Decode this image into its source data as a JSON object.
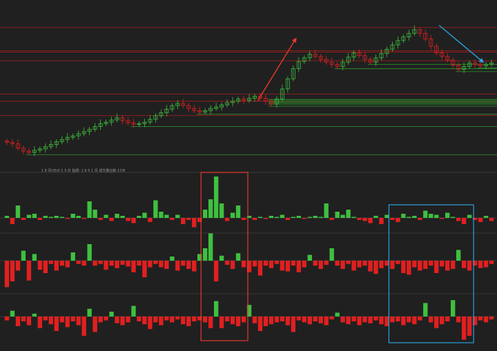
{
  "colors": {
    "background": "#202020",
    "up": "#3fbf3f",
    "down": "#e02020",
    "support_line": "#2e9e2e",
    "resistance_line": "#b01e1e",
    "annotation_red": "#e83a2a",
    "annotation_blue": "#2aa3e0"
  },
  "chart_data": [
    {
      "type": "candlestick",
      "title": "",
      "x_axis_text": "1 6 月(日)0 1 3 日 指標: 1 6 5 1 月 成交量比較 17/8",
      "close": [
        8.2,
        8.0,
        7.4,
        7.0,
        6.8,
        7.1,
        7.3,
        7.6,
        7.9,
        8.3,
        8.6,
        8.9,
        9.1,
        9.4,
        9.7,
        10.0,
        10.4,
        10.8,
        11.0,
        11.3,
        11.6,
        11.2,
        10.9,
        10.7,
        10.8,
        11.0,
        11.4,
        11.9,
        12.3,
        12.8,
        13.3,
        13.6,
        13.3,
        12.9,
        12.6,
        12.4,
        12.6,
        12.9,
        13.1,
        13.4,
        13.7,
        13.9,
        14.2,
        14.0,
        14.3,
        14.6,
        14.3,
        13.9,
        13.5,
        14.2,
        15.6,
        17.0,
        18.4,
        19.4,
        19.9,
        20.4,
        20.1,
        19.7,
        19.3,
        19.0,
        18.7,
        19.3,
        20.0,
        20.6,
        20.2,
        19.7,
        19.3,
        19.9,
        20.5,
        21.1,
        21.7,
        22.3,
        22.8,
        23.3,
        23.8,
        23.3,
        22.5,
        21.5,
        20.6,
        20.1,
        19.6,
        18.9,
        18.3,
        18.7,
        19.2,
        19.0,
        18.8,
        19.0,
        19.2
      ]
    },
    {
      "type": "bar",
      "title": "",
      "values": [
        0.2,
        -0.6,
        1.2,
        -0.2,
        0.3,
        0.4,
        -0.2,
        0.2,
        0.1,
        0.2,
        0.1,
        -0.1,
        0.4,
        0.2,
        -0.1,
        1.6,
        0.8,
        -0.2,
        0.3,
        -0.3,
        0.4,
        0.2,
        -0.3,
        -0.5,
        0.2,
        0.5,
        -0.4,
        1.7,
        0.6,
        0.3,
        -0.2,
        0.3,
        -0.6,
        -0.2,
        -0.9,
        -0.4,
        0.8,
        1.8,
        4.0,
        1.4,
        -0.3,
        0.5,
        1.2,
        -0.2,
        0.2,
        -0.2,
        0.1,
        -0.1,
        0.2,
        0.1,
        0.3,
        -0.2,
        0.1,
        0.2,
        -0.1,
        0.1,
        0.2,
        0.1,
        1.4,
        -0.2,
        0.6,
        0.3,
        0.8,
        0.1,
        -0.2,
        -0.3,
        -0.5,
        0.2,
        -0.6,
        0.3,
        -0.2,
        -0.4,
        0.4,
        0.1,
        0.2,
        -0.2,
        0.7,
        0.4,
        0.3,
        -0.1,
        0.5,
        0.1,
        -0.3,
        -0.6,
        0.3,
        -0.2,
        -0.4,
        0.2,
        -0.3
      ]
    },
    {
      "type": "bar",
      "title": "",
      "values": [
        -3.2,
        -2.5,
        -1.2,
        1.2,
        -2.4,
        0.8,
        -1.1,
        -1.5,
        -0.4,
        -1.2,
        -0.6,
        -0.8,
        1.0,
        -0.4,
        -0.6,
        2.0,
        -0.6,
        -0.4,
        -1.1,
        -0.6,
        -0.9,
        -0.5,
        -0.7,
        -1.4,
        -0.6,
        -2.0,
        -0.8,
        -0.4,
        -0.8,
        -1.0,
        0.5,
        -1.2,
        -0.6,
        -1.0,
        -1.3,
        0.8,
        1.5,
        3.3,
        -2.5,
        0.6,
        -0.5,
        -1.0,
        0.9,
        -0.8,
        -1.4,
        -0.7,
        -1.8,
        -0.6,
        -0.9,
        -0.4,
        -1.2,
        -1.3,
        -0.6,
        -1.4,
        -0.8,
        0.7,
        -0.6,
        -1.0,
        -0.5,
        1.5,
        -0.6,
        -1.0,
        -0.4,
        -1.2,
        -0.8,
        -0.6,
        -1.3,
        -1.6,
        -0.9,
        -0.6,
        -1.0,
        -0.4,
        -1.5,
        -1.7,
        -0.8,
        -1.2,
        -1.0,
        -0.6,
        -1.5,
        -0.7,
        -1.2,
        -1.0,
        1.3,
        -0.9,
        -1.2,
        -0.6,
        -0.9,
        -0.8,
        -0.4
      ]
    },
    {
      "type": "bar",
      "title": "",
      "values": [
        -0.4,
        0.6,
        -1.0,
        -0.5,
        -0.9,
        0.3,
        -1.2,
        -0.4,
        -0.8,
        -1.5,
        -0.6,
        -1.1,
        -0.5,
        -0.9,
        -2.0,
        0.8,
        -1.6,
        -0.6,
        -0.4,
        0.5,
        -0.7,
        -0.9,
        -0.6,
        1.1,
        -0.5,
        -0.8,
        -1.3,
        -0.6,
        -0.9,
        -0.4,
        -0.6,
        -0.3,
        -0.8,
        -1.0,
        -0.5,
        -0.4,
        -0.6,
        -1.2,
        1.6,
        -1.2,
        -0.5,
        -0.8,
        -1.0,
        -0.6,
        1.2,
        -0.7,
        -1.5,
        -1.0,
        -0.8,
        -0.6,
        -0.5,
        -0.9,
        -1.6,
        -0.4,
        -0.6,
        -0.8,
        -0.5,
        -0.7,
        -0.9,
        -0.3,
        0.4,
        -0.6,
        -0.8,
        -0.5,
        -0.9,
        -0.6,
        -0.7,
        -0.4,
        -0.8,
        -1.0,
        -0.6,
        -0.5,
        -0.9,
        -0.6,
        -0.8,
        -0.4,
        1.4,
        -0.6,
        -1.2,
        -0.8,
        -0.5,
        1.7,
        -0.6,
        -2.4,
        -2.0,
        -0.9,
        -0.4,
        -0.6,
        -0.3
      ]
    }
  ]
}
